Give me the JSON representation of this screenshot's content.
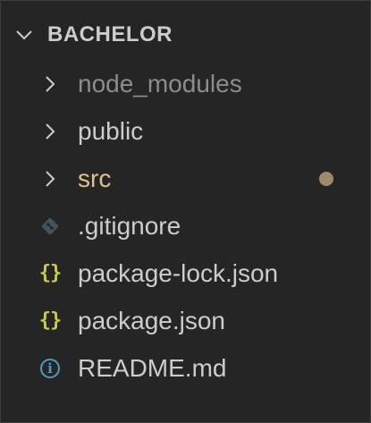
{
  "explorer": {
    "folder_name": "BACHELOR",
    "items": [
      {
        "label": "node_modules",
        "kind": "folder",
        "icon": "chevron-right-icon"
      },
      {
        "label": "public",
        "kind": "folder",
        "icon": "chevron-right-icon"
      },
      {
        "label": "src",
        "kind": "folder",
        "icon": "chevron-right-icon",
        "modified": true
      },
      {
        "label": ".gitignore",
        "kind": "file",
        "icon": "git-icon"
      },
      {
        "label": "package-lock.json",
        "kind": "file",
        "icon": "json-braces-icon",
        "icon_text": "{}"
      },
      {
        "label": "package.json",
        "kind": "file",
        "icon": "json-braces-icon",
        "icon_text": "{}"
      },
      {
        "label": "README.md",
        "kind": "file",
        "icon": "info-icon",
        "icon_text": "i"
      }
    ]
  },
  "colors": {
    "background": "#252526",
    "text": "#cccccc",
    "ignored_text": "#8c8c8c",
    "modified_text": "#e2c08d",
    "modified_dot": "#a08968",
    "json_icon": "#cbcb41",
    "info_icon": "#519aba",
    "git_icon": "#41535b"
  }
}
